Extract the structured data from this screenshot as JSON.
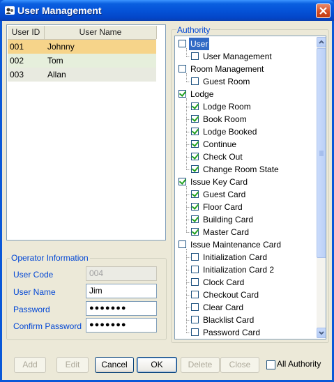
{
  "window": {
    "title": "User Management",
    "icon": "user-management-app-icon"
  },
  "user_list": {
    "columns": [
      "User ID",
      "User Name"
    ],
    "rows": [
      {
        "id": "001",
        "name": "Johnny",
        "state": "selected"
      },
      {
        "id": "002",
        "name": "Tom",
        "state": "normal"
      },
      {
        "id": "003",
        "name": "Allan",
        "state": "normal"
      }
    ]
  },
  "operator": {
    "legend": "Operator Information",
    "user_code_label": "User Code",
    "user_code_value": "004",
    "user_name_label": "User Name",
    "user_name_value": "Jim",
    "password_label": "Password",
    "password_value": "●●●●●●●",
    "confirm_label": "Confirm Password",
    "confirm_value": "●●●●●●●"
  },
  "authority": {
    "legend": "Authority",
    "items": [
      {
        "label": "User",
        "level": 0,
        "checked": false,
        "selected": true
      },
      {
        "label": "User Management",
        "level": 1,
        "checked": false
      },
      {
        "label": "Room Management",
        "level": 0,
        "checked": false
      },
      {
        "label": "Guest Room",
        "level": 1,
        "checked": false
      },
      {
        "label": "Lodge",
        "level": 0,
        "checked": true
      },
      {
        "label": "Lodge Room",
        "level": 1,
        "checked": true
      },
      {
        "label": "Book Room",
        "level": 1,
        "checked": true
      },
      {
        "label": "Lodge Booked",
        "level": 1,
        "checked": true
      },
      {
        "label": "Continue",
        "level": 1,
        "checked": true
      },
      {
        "label": "Check Out",
        "level": 1,
        "checked": true
      },
      {
        "label": "Change Room State",
        "level": 1,
        "checked": true
      },
      {
        "label": "Issue Key Card",
        "level": 0,
        "checked": true
      },
      {
        "label": "Guest Card",
        "level": 1,
        "checked": true
      },
      {
        "label": "Floor Card",
        "level": 1,
        "checked": true
      },
      {
        "label": "Building Card",
        "level": 1,
        "checked": true
      },
      {
        "label": "Master Card",
        "level": 1,
        "checked": true
      },
      {
        "label": "Issue Maintenance Card",
        "level": 0,
        "checked": false
      },
      {
        "label": "Initialization Card",
        "level": 1,
        "checked": false
      },
      {
        "label": "Initialization Card 2",
        "level": 1,
        "checked": false
      },
      {
        "label": "Clock Card",
        "level": 1,
        "checked": false
      },
      {
        "label": "Checkout Card",
        "level": 1,
        "checked": false
      },
      {
        "label": "Clear Card",
        "level": 1,
        "checked": false
      },
      {
        "label": "Blacklist Card",
        "level": 1,
        "checked": false
      },
      {
        "label": "Password Card",
        "level": 1,
        "checked": false
      }
    ]
  },
  "buttons": {
    "add": "Add",
    "edit": "Edit",
    "cancel": "Cancel",
    "ok": "OK",
    "delete": "Delete",
    "close": "Close"
  },
  "all_authority": {
    "label": "All Authority",
    "checked": false
  },
  "colors": {
    "row_selected": "#f6d48a",
    "row_alt_1": "#e6efdc",
    "row_alt_2": "#e8eae0",
    "tree_selection": "#316ac5",
    "label_blue": "#0046d5"
  }
}
